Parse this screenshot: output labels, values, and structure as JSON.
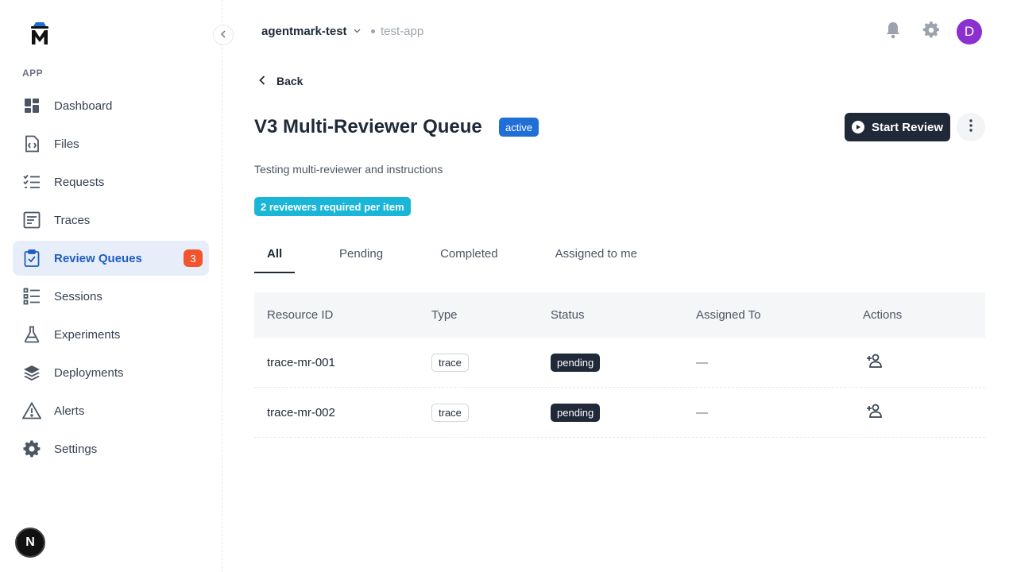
{
  "sidebar": {
    "section_label": "APP",
    "items": [
      {
        "label": "Dashboard",
        "icon": "dashboard-icon"
      },
      {
        "label": "Files",
        "icon": "code-file-icon"
      },
      {
        "label": "Requests",
        "icon": "checklist-icon"
      },
      {
        "label": "Traces",
        "icon": "document-icon"
      },
      {
        "label": "Review Queues",
        "icon": "clipboard-check-icon",
        "badge": "3"
      },
      {
        "label": "Sessions",
        "icon": "list-tree-icon"
      },
      {
        "label": "Experiments",
        "icon": "flask-icon"
      },
      {
        "label": "Deployments",
        "icon": "layers-icon"
      },
      {
        "label": "Alerts",
        "icon": "warning-icon"
      },
      {
        "label": "Settings",
        "icon": "gear-icon"
      }
    ],
    "active_item": "Review Queues",
    "next_button": "N"
  },
  "header": {
    "org": "agentmark-test",
    "app": "test-app",
    "avatar_initial": "D"
  },
  "main": {
    "back_label": "Back",
    "title": "V3 Multi-Reviewer Queue",
    "status": "active",
    "start_review_label": "Start Review",
    "description": "Testing multi-reviewer and instructions",
    "reviewers_tag": "2 reviewers required per item",
    "tabs": [
      {
        "label": "All",
        "active": true
      },
      {
        "label": "Pending"
      },
      {
        "label": "Completed"
      },
      {
        "label": "Assigned to me"
      }
    ],
    "table": {
      "headers": [
        "Resource ID",
        "Type",
        "Status",
        "Assigned To",
        "Actions"
      ],
      "rows": [
        {
          "resource_id": "trace-mr-001",
          "type": "trace",
          "status": "pending",
          "assigned_to": "—"
        },
        {
          "resource_id": "trace-mr-002",
          "type": "trace",
          "status": "pending",
          "assigned_to": "—"
        }
      ]
    }
  },
  "colors": {
    "accent": "#1d5dbf",
    "active_bg": "#e8eef9",
    "badge": "#f2542d",
    "status_active": "#1f6fd6",
    "reviewers_tag": "#19b6d8",
    "dark": "#1f2937",
    "avatar": "#8b2fd1"
  }
}
